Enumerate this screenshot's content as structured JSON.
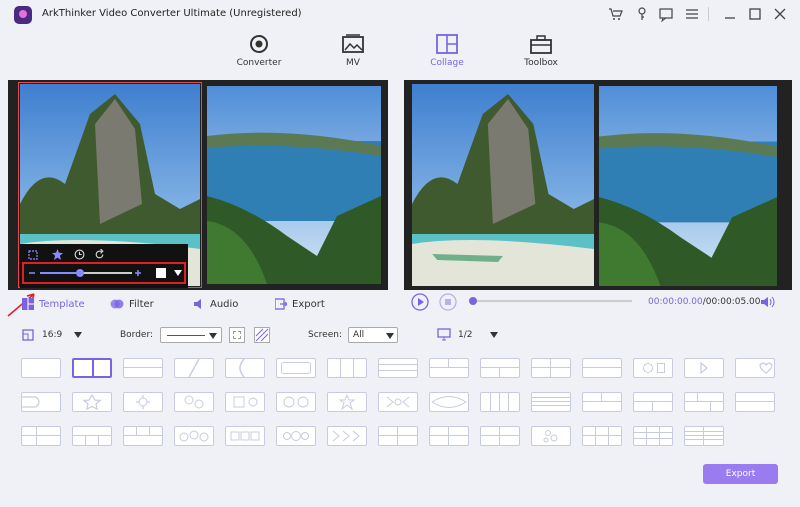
{
  "app": {
    "title": "ArkThinker Video Converter Ultimate (Unregistered)"
  },
  "nav": [
    {
      "label": "Converter"
    },
    {
      "label": "MV"
    },
    {
      "label": "Collage"
    },
    {
      "label": "Toolbox"
    }
  ],
  "tabs": {
    "template": "Template",
    "filter": "Filter",
    "audio": "Audio",
    "export": "Export"
  },
  "player": {
    "current_time": "00:00:00.00",
    "total_time": "/00:00:05.00"
  },
  "options": {
    "aspect": "16:9",
    "border_label": "Border:",
    "screen_label": "Screen:",
    "screen_value": "All",
    "page": "1/2"
  },
  "export_button": "Export",
  "colors": {
    "accent": "#7b63e0",
    "highlight": "#e02020"
  }
}
